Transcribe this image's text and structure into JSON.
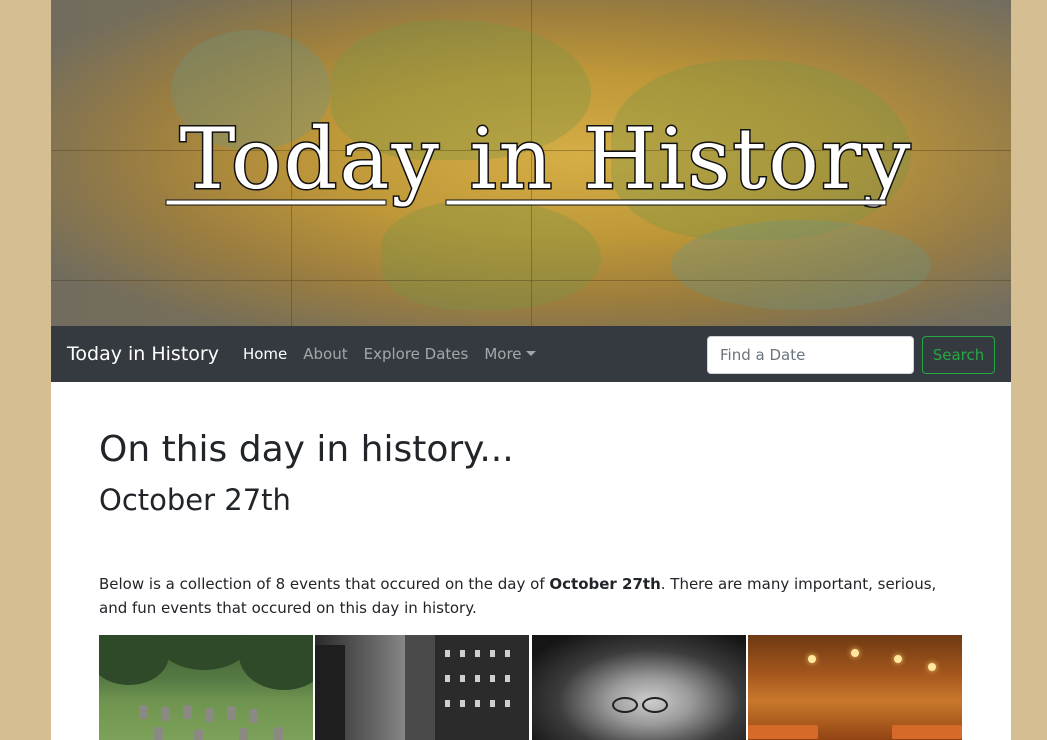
{
  "banner": {
    "title": "Today in History"
  },
  "navbar": {
    "brand": "Today in History",
    "links": [
      {
        "label": "Home",
        "active": true
      },
      {
        "label": "About",
        "active": false
      },
      {
        "label": "Explore Dates",
        "active": false
      },
      {
        "label": "More",
        "active": false,
        "dropdown": true
      }
    ],
    "search": {
      "placeholder": "Find a Date",
      "value": "",
      "button_label": "Search"
    }
  },
  "main": {
    "heading": "On this day in history...",
    "date": "October 27th",
    "intro_before": "Below is a collection of 8 events that occured on the day of ",
    "intro_bold": "October 27th",
    "intro_after": ". There are many important, serious, and fun events that occured on this day in history."
  },
  "colors": {
    "page_background": "#d5bf92",
    "navbar": "#343a40",
    "search_button": "#28a745"
  }
}
